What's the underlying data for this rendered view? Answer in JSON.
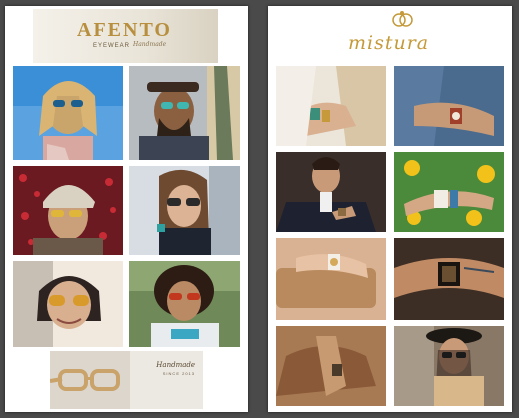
{
  "left_page": {
    "logo": {
      "brand": "AFENTO",
      "line": "EYEWEAR",
      "tagline": "Handmade"
    },
    "footer_banner": {
      "script": "Handmade",
      "since": "SINCE 2013"
    }
  },
  "right_page": {
    "logo": {
      "brand": "mistura"
    }
  },
  "colors": {
    "background": "#4a4a4a",
    "page": "#ffffff",
    "brand_gold": "#b78f3e"
  }
}
